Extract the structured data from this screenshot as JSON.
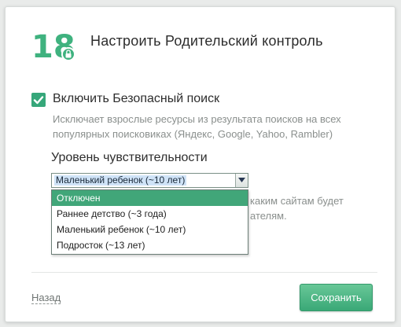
{
  "dialog": {
    "logo_text": "18",
    "logo_icon": "lock-icon",
    "title": "Настроить Родительский контроль"
  },
  "safe_search": {
    "checked": true,
    "label": "Включить Безопасный поиск",
    "description": "Исключает взрослые ресурсы из результата поисков на всех популярных поисковиках (Яндекс, Google, Yahoo, Rambler)"
  },
  "sensitivity": {
    "label": "Уровень чувствительности",
    "selected_value": "Маленький ребенок (~10 лет)",
    "options": [
      "Отключен",
      "Раннее детство (~3 года)",
      "Маленький ребенок (~10 лет)",
      "Подросток (~13 лет)"
    ],
    "highlighted_option": "Отключен",
    "obscured_text_line1": "каким сайтам будет",
    "obscured_text_line2": "ателям."
  },
  "footer": {
    "back_label": "Назад",
    "save_label": "Сохранить"
  },
  "colors": {
    "accent": "#36a77a",
    "logo": "#3fb27f",
    "selection_blue": "#cfe3f7",
    "text": "#2d2d2d",
    "muted_text": "#8a8f8d"
  }
}
